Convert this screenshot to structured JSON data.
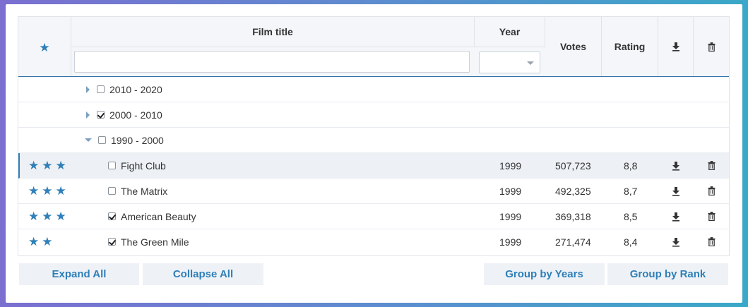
{
  "header": {
    "favorite_icon": "star-icon",
    "title_label": "Film title",
    "year_label": "Year",
    "votes_label": "Votes",
    "rating_label": "Rating",
    "download_icon": "download-icon",
    "delete_icon": "trash-icon",
    "title_filter_value": "",
    "year_filter_value": ""
  },
  "groups": [
    {
      "label": "2010 - 2020",
      "expanded": false,
      "checked": false
    },
    {
      "label": "2000 - 2010",
      "expanded": false,
      "checked": true
    },
    {
      "label": "1990 - 2000",
      "expanded": true,
      "checked": false
    }
  ],
  "films": [
    {
      "stars": "★★★",
      "rank": 3,
      "title": "Fight Club",
      "checked": false,
      "year": "1999",
      "votes": "507,723",
      "rating": "8,8",
      "selected": true
    },
    {
      "stars": "★★★",
      "rank": 3,
      "title": "The Matrix",
      "checked": false,
      "year": "1999",
      "votes": "492,325",
      "rating": "8,7",
      "selected": false
    },
    {
      "stars": "★★★",
      "rank": 3,
      "title": "American Beauty",
      "checked": true,
      "year": "1999",
      "votes": "369,318",
      "rating": "8,5",
      "selected": false
    },
    {
      "stars": "★★",
      "rank": 2,
      "title": "The Green Mile",
      "checked": true,
      "year": "1999",
      "votes": "271,474",
      "rating": "8,4",
      "selected": false
    }
  ],
  "buttons": {
    "expand_all": "Expand All",
    "collapse_all": "Collapse All",
    "group_by_years": "Group by Years",
    "group_by_rank": "Group by Rank"
  },
  "colors": {
    "accent": "#2f7fb8",
    "header_bg": "#f4f6f9",
    "selected_row_bg": "#edf0f4",
    "button_bg": "#eef2f7"
  }
}
